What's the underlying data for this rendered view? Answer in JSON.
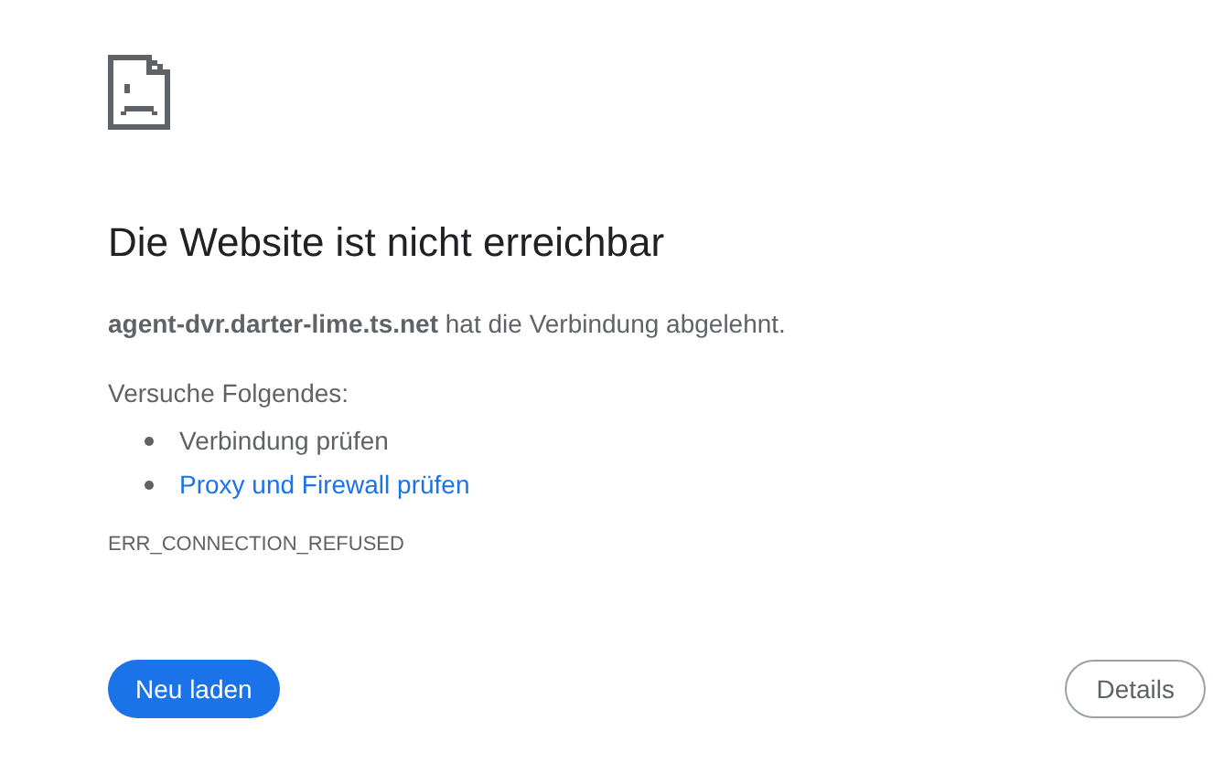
{
  "title": "Die Website ist nicht erreichbar",
  "message": "**agent-dvr.darter-lime.ts.net** hat die Verbindung abgelehnt.",
  "suggestions_heading": "Versuche Folgendes:",
  "suggestions": [
    {
      "kind": "text",
      "label": "Verbindung prüfen"
    },
    {
      "kind": "link",
      "label": "Proxy und Firewall prüfen"
    }
  ],
  "error_code": "ERR_CONNECTION_REFUSED",
  "buttons": [
    {
      "kind": "primary",
      "label": "Neu laden"
    },
    {
      "kind": "secondary",
      "label": "Details"
    }
  ]
}
